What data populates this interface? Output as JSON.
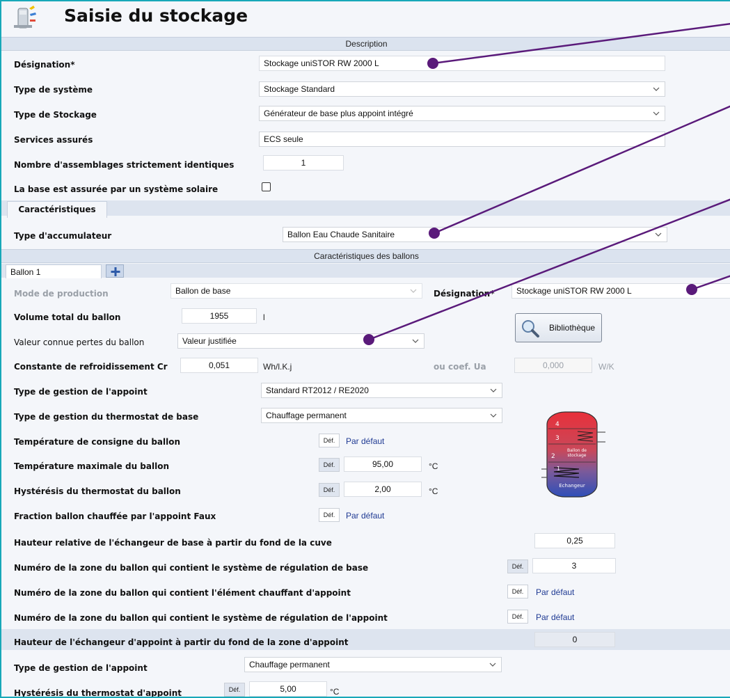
{
  "window": {
    "title": "Saisie du stockage",
    "icon": "storage-tank-icon"
  },
  "sections": {
    "description": "Description",
    "caracteristiques_tab": "Caractéristiques",
    "ballons": "Caractéristiques des ballons"
  },
  "description": {
    "designation_label": "Désignation*",
    "designation_value": "Stockage uniSTOR RW 2000 L",
    "type_systeme_label": "Type de système",
    "type_systeme_value": "Stockage Standard",
    "type_stockage_label": "Type de Stockage",
    "type_stockage_value": "Générateur de base plus appoint intégré",
    "services_label": "Services assurés",
    "services_value": "ECS seule",
    "nb_assemblages_label": "Nombre d'assemblages strictement identiques",
    "nb_assemblages_value": "1",
    "solaire_label": "La base est assurée par un système solaire",
    "solaire_checked": false
  },
  "caracteristiques": {
    "type_accumulateur_label": "Type d'accumulateur",
    "type_accumulateur_value": "Ballon Eau Chaude Sanitaire"
  },
  "ballon_tabs": [
    {
      "label": "Ballon 1"
    }
  ],
  "add_tab_icon": "plus-icon",
  "ballon": {
    "mode_production_label": "Mode de production",
    "mode_production_value": "Ballon de base",
    "designation_label": "Désignation*",
    "designation_value": "Stockage uniSTOR RW 2000 L",
    "volume_label": "Volume total du ballon",
    "volume_value": "1955",
    "volume_unit": "l",
    "bibliotheque_label": "Bibliothèque",
    "pertes_label": "Valeur connue pertes du ballon",
    "pertes_value": "Valeur justifiée",
    "cr_label": "Constante de refroidissement  Cr",
    "cr_value": "0,051",
    "cr_unit": "Wh/l.K.j",
    "ua_label": "ou coef. Ua",
    "ua_value": "0,000",
    "ua_unit": "W/K",
    "gestion_appoint_label": "Type de gestion de l'appoint",
    "gestion_appoint_value": "Standard RT2012 / RE2020",
    "gestion_thermostat_label": "Type de gestion du thermostat de base",
    "gestion_thermostat_value": "Chauffage permanent",
    "temp_consigne_label": "Température de consigne du ballon",
    "temp_consigne_value": "Par défaut",
    "temp_max_label": "Température maximale du ballon",
    "temp_max_value": "95,00",
    "temp_unit": "°C",
    "hysteresis_label": "Hystérésis du thermostat du ballon",
    "hysteresis_value": "2,00",
    "fraction_label": "Fraction ballon chauffée par l'appoint Faux",
    "fraction_value": "Par défaut",
    "def_label": "Déf.",
    "hauteur_echangeur_label": "Hauteur relative de l'échangeur de base à partir du fond de la cuve",
    "hauteur_echangeur_value": "0,25",
    "zone_regulation_base_label": "Numéro de la zone du ballon qui contient le système de régulation de base",
    "zone_regulation_base_value": "3",
    "zone_element_appoint_label": "Numéro de la zone du ballon qui contient l'élément chauffant d'appoint",
    "zone_element_appoint_value": "Par défaut",
    "zone_regulation_appoint_label": "Numéro de la zone du ballon qui contient le système de régulation de l'appoint",
    "zone_regulation_appoint_value": "Par défaut",
    "hauteur_appoint_label": "Hauteur de l'échangeur d'appoint à partir du fond de la zone d'appoint",
    "hauteur_appoint_value": "0",
    "gestion_appoint2_label": "Type de gestion de l'appoint",
    "gestion_appoint2_value": "Chauffage permanent",
    "hysteresis_appoint_label": "Hystérésis du thermostat d'appoint",
    "hysteresis_appoint_value": "5,00",
    "hysteresis_appoint_unit": "°C"
  },
  "diagram": {
    "zones": [
      "4",
      "3",
      "2",
      "1"
    ],
    "tank_label": "Ballon de stockage",
    "exchanger_label": "Echangeur"
  },
  "colors": {
    "frame": "#17a8b8",
    "section_bar": "#dbe3ef",
    "annotation": "#5a1a7a",
    "link": "#1f3a93"
  }
}
